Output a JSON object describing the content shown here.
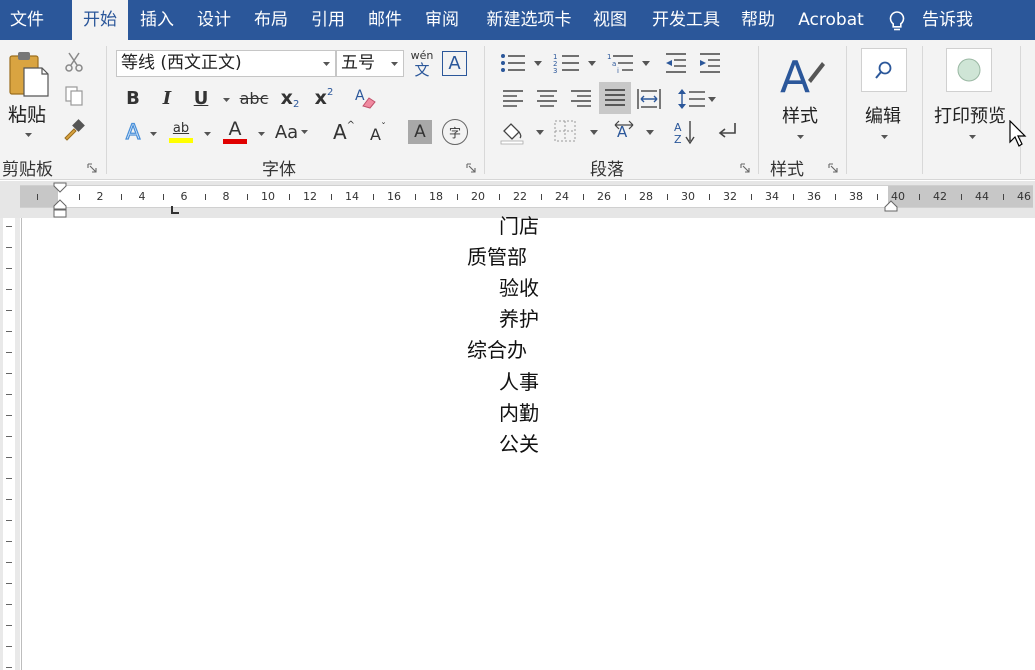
{
  "tabs": [
    "文件",
    "开始",
    "插入",
    "设计",
    "布局",
    "引用",
    "邮件",
    "审阅",
    "新建选项卡",
    "视图",
    "开发工具",
    "帮助",
    "Acrobat",
    "告诉我"
  ],
  "clipboard": {
    "paste_label": "粘贴",
    "group_label": "剪贴板"
  },
  "font": {
    "name": "等线 (西文正文)",
    "size": "五号",
    "group_label": "字体",
    "bold": "B",
    "italic": "I",
    "underline": "U",
    "strike": "abc",
    "subscript": "x",
    "superscript": "x",
    "sub_mark": "2",
    "sup_mark": "2",
    "phonetic_top": "wén",
    "phonetic_bottom": "文",
    "border_char": "A",
    "effects": "A",
    "highlight": "ab",
    "font_color": "A",
    "case": "Aa",
    "grow": "A",
    "shrink": "A",
    "shading": "A",
    "enclose": "字",
    "colors": {
      "highlight": "#ffff00",
      "font_color": "#e00000",
      "effects": "#4a90d9"
    }
  },
  "paragraph": {
    "group_label": "段落"
  },
  "styles": {
    "label": "样式",
    "group_label": "样式"
  },
  "editing": {
    "label": "编辑"
  },
  "print_preview": {
    "label": "打印预览"
  },
  "ruler_numbers": [
    "2",
    "4",
    "6",
    "8",
    "10",
    "12",
    "14",
    "16",
    "18",
    "20",
    "22",
    "24",
    "26",
    "28",
    "30",
    "32",
    "34",
    "36",
    "38",
    "40",
    "42",
    "44",
    "46"
  ],
  "document_lines": [
    {
      "text": "门店",
      "level": 2
    },
    {
      "text": "质管部",
      "level": 1
    },
    {
      "text": "验收",
      "level": 2
    },
    {
      "text": "养护",
      "level": 2
    },
    {
      "text": "综合办",
      "level": 1
    },
    {
      "text": "人事",
      "level": 2
    },
    {
      "text": "内勤",
      "level": 2
    },
    {
      "text": "公关",
      "level": 2
    }
  ],
  "theme": {
    "accent": "#2b579a",
    "ribbon_bg": "#f3f3f3"
  }
}
